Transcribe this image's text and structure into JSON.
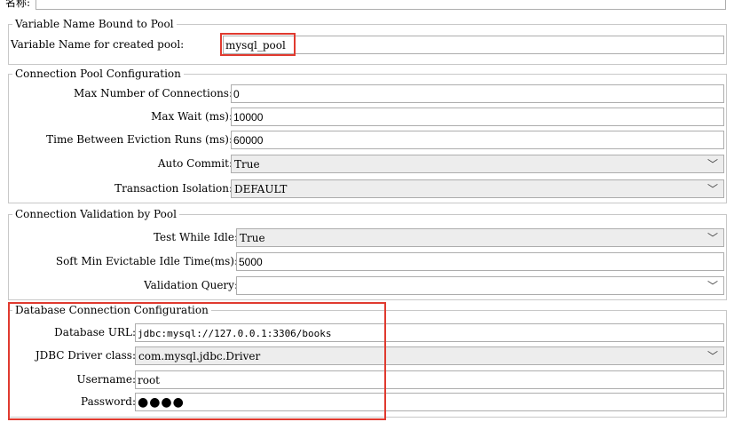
{
  "top": {
    "name_label": "名称:"
  },
  "group_pool_var": {
    "legend": "Variable Name Bound to Pool",
    "created_pool_label": "Variable Name for created pool:",
    "created_pool_value": "mysql_pool"
  },
  "group_pool_config": {
    "legend": "Connection Pool Configuration",
    "max_conn_label": "Max Number of Connections:",
    "max_conn_value": "0",
    "max_wait_label": "Max Wait (ms):",
    "max_wait_value": "10000",
    "eviction_label": "Time Between Eviction Runs (ms):",
    "eviction_value": "60000",
    "auto_commit_label": "Auto Commit:",
    "auto_commit_value": "True",
    "isolation_label": "Transaction Isolation:",
    "isolation_value": "DEFAULT"
  },
  "group_validation": {
    "legend": "Connection Validation by Pool",
    "test_idle_label": "Test While Idle:",
    "test_idle_value": "True",
    "soft_min_label": "Soft Min Evictable Idle Time(ms):",
    "soft_min_value": "5000",
    "validation_query_label": "Validation Query:",
    "validation_query_value": ""
  },
  "group_db": {
    "legend": "Database Connection Configuration",
    "url_label": "Database URL:",
    "url_value": "jdbc:mysql://127.0.0.1:3306/books",
    "driver_label": "JDBC Driver class:",
    "driver_value": "com.mysql.jdbc.Driver",
    "username_label": "Username:",
    "username_value": "root",
    "password_label": "Password:",
    "password_value": "●●●●"
  },
  "icons": {
    "dropdown": "chevron-down-icon"
  },
  "colors": {
    "highlight": "#e03a2f"
  }
}
